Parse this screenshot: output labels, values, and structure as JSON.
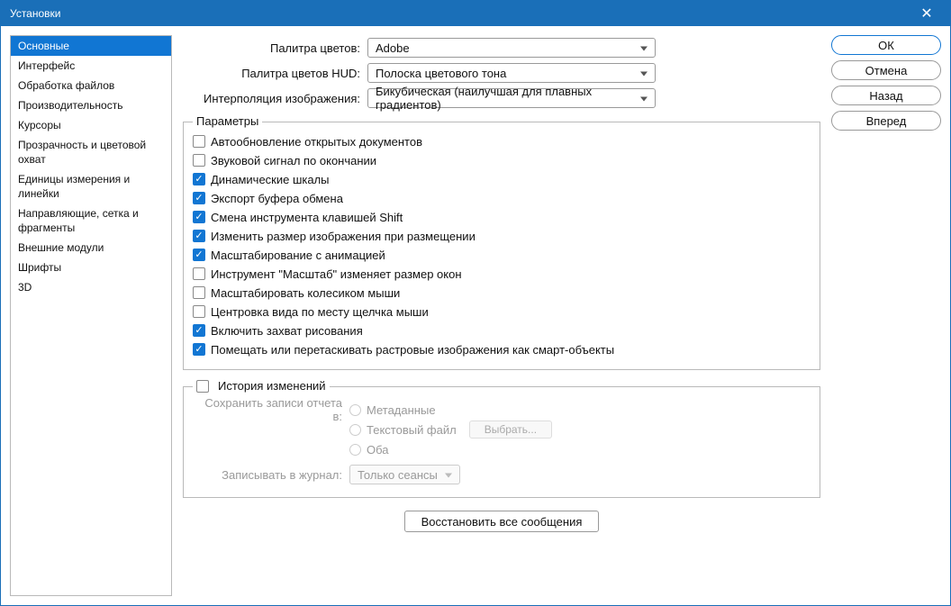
{
  "titlebar": {
    "title": "Установки"
  },
  "sidebar": {
    "items": [
      "Основные",
      "Интерфейс",
      "Обработка файлов",
      "Производительность",
      "Курсоры",
      "Прозрачность и цветовой охват",
      "Единицы измерения и линейки",
      "Направляющие, сетка и фрагменты",
      "Внешние модули",
      "Шрифты",
      "3D"
    ],
    "selected": 0
  },
  "form": {
    "row1": {
      "label": "Палитра цветов:",
      "value": "Adobe"
    },
    "row2": {
      "label": "Палитра цветов HUD:",
      "value": "Полоска цветового тона"
    },
    "row3": {
      "label": "Интерполяция изображения:",
      "value": "Бикубическая (наилучшая для плавных градиентов)"
    }
  },
  "params": {
    "legend": "Параметры",
    "checks": [
      {
        "label": "Автообновление открытых документов",
        "checked": false
      },
      {
        "label": "Звуковой сигнал по окончании",
        "checked": false
      },
      {
        "label": "Динамические шкалы",
        "checked": true
      },
      {
        "label": "Экспорт буфера обмена",
        "checked": true
      },
      {
        "label": "Смена инструмента клавишей Shift",
        "checked": true
      },
      {
        "label": "Изменить размер изображения при размещении",
        "checked": true
      },
      {
        "label": "Масштабирование с анимацией",
        "checked": true
      },
      {
        "label": "Инструмент \"Масштаб\" изменяет размер окон",
        "checked": false
      },
      {
        "label": "Масштабировать колесиком мыши",
        "checked": false
      },
      {
        "label": "Центровка вида по месту щелчка мыши",
        "checked": false
      },
      {
        "label": "Включить захват рисования",
        "checked": true
      },
      {
        "label": "Помещать или перетаскивать растровые изображения как смарт-объекты",
        "checked": true
      }
    ]
  },
  "history": {
    "legend": "История изменений",
    "save_label": "Сохранить записи отчета в:",
    "opt_meta": "Метаданные",
    "opt_file": "Текстовый файл",
    "opt_both": "Оба",
    "choose_btn": "Выбрать...",
    "log_label": "Записывать в журнал:",
    "log_value": "Только сеансы"
  },
  "reset_btn": "Восстановить все сообщения",
  "buttons": {
    "ok": "ОК",
    "cancel": "Отмена",
    "back": "Назад",
    "forward": "Вперед"
  }
}
